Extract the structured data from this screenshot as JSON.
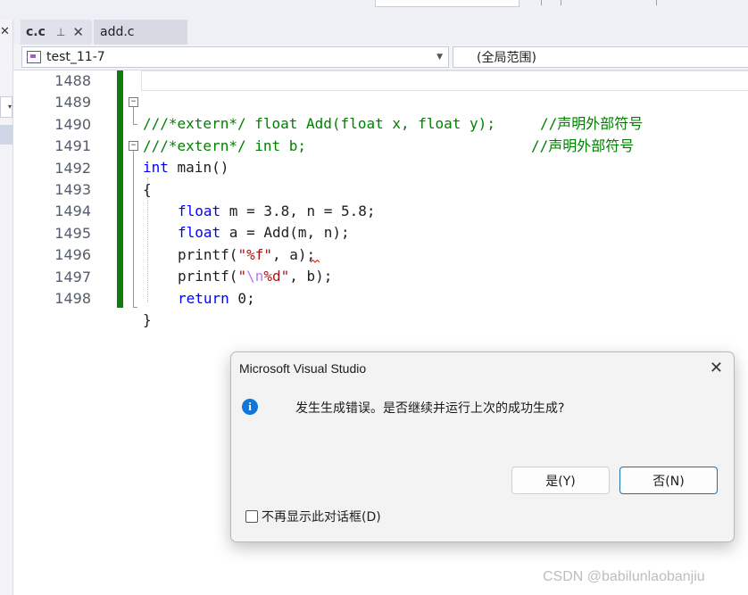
{
  "tabs": [
    {
      "label": "c.c",
      "pinned": true
    },
    {
      "label": "add.c"
    }
  ],
  "navbar": {
    "project": "test_11-7",
    "scope": "(全局范围)"
  },
  "editor": {
    "lines": [
      {
        "no": "1488"
      },
      {
        "no": "1489"
      },
      {
        "no": "1490"
      },
      {
        "no": "1491"
      },
      {
        "no": "1492"
      },
      {
        "no": "1493"
      },
      {
        "no": "1494"
      },
      {
        "no": "1495"
      },
      {
        "no": "1496"
      },
      {
        "no": "1497"
      },
      {
        "no": "1498"
      }
    ],
    "tokens": {
      "l1489_c1": "///*extern*/ float Add(float x, float y);",
      "l1489_c2": "//声明外部符号",
      "l1490_c1": "///*extern*/ int b;",
      "l1490_c2": "//声明外部符号",
      "kw_int": "int",
      "main": " main()",
      "brace_open": "{",
      "kw_float": "float",
      "l1493_rest": " m = 3.8, n = 5.8;",
      "l1494_rest": " a = Add(m, n);",
      "printf": "printf",
      "paren_open": "(",
      "str1": "\"%f\"",
      "l1495_rest": ", a);",
      "str2_q1": "\"",
      "str2_esc": "\\n",
      "str2_rest": "%d\"",
      "l1496_comma": ", ",
      "l1496_b": "b",
      "l1496_end": ");",
      "kw_return": "return",
      "l1497_rest": " 0;",
      "brace_close": "}"
    }
  },
  "dialog": {
    "title": "Microsoft Visual Studio",
    "message": "发生生成错误。是否继续并运行上次的成功生成?",
    "yes_label": "是(Y)",
    "no_label": "否(N)",
    "checkbox_label": "不再显示此对话框(D)",
    "checkbox_checked": false,
    "icon": "info-icon"
  },
  "watermark": "CSDN @babilunlaobanjiu",
  "colors": {
    "keyword": "#0000ff",
    "comment": "#008000",
    "string": "#a31515",
    "change_bar": "#107c10",
    "info": "#1177d6"
  }
}
